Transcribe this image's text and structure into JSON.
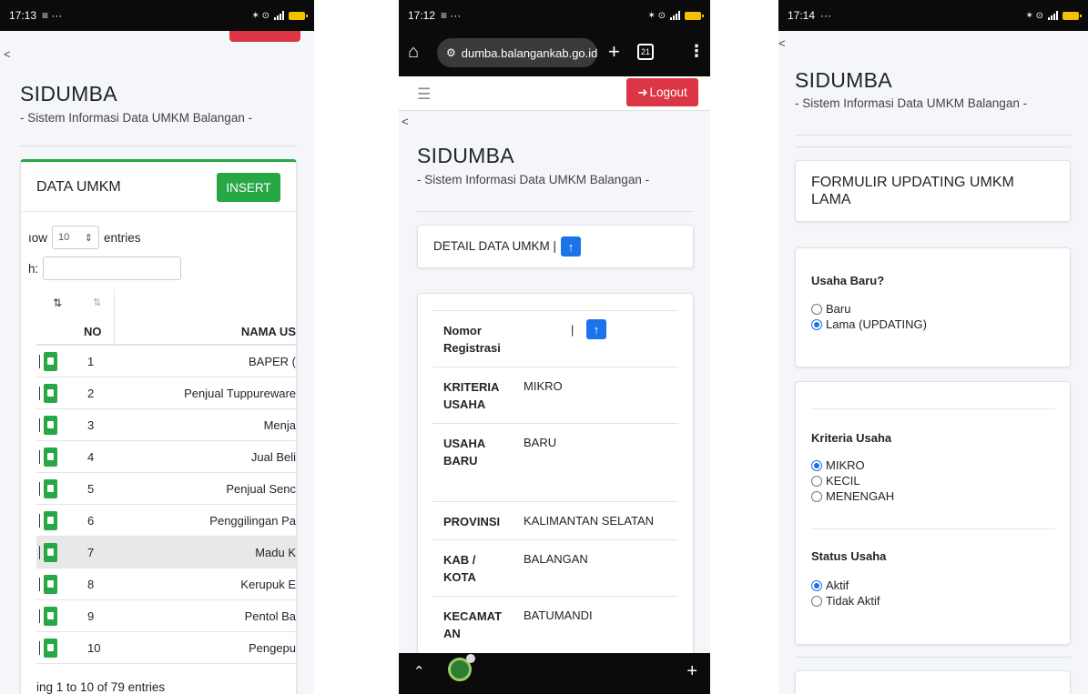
{
  "common": {
    "back": "<",
    "brand": "SIDUMBA",
    "tagline": "- Sistem Informasi Data UMKM Balangan -"
  },
  "phone1": {
    "status": {
      "time": "17:13",
      "icons_left": "≡ ···",
      "net": "✶ ⊙"
    },
    "card_title": "DATA UMKM",
    "insert_label": "INSERT",
    "show_prefix": "ıow",
    "entries_value": "10",
    "show_suffix": "entries",
    "search_label": "h:",
    "sort_icon_1": "⇅",
    "sort_icon_2": "⇅",
    "col_no": "NO",
    "col_nama": "NAMA US",
    "rows": [
      {
        "no": "1",
        "nama": "BAPER ("
      },
      {
        "no": "2",
        "nama": "Penjual Tuppureware"
      },
      {
        "no": "3",
        "nama": "Menja"
      },
      {
        "no": "4",
        "nama": "Jual Beli"
      },
      {
        "no": "5",
        "nama": "Penjual Senc"
      },
      {
        "no": "6",
        "nama": "Penggilingan Pa"
      },
      {
        "no": "7",
        "nama": "Madu K"
      },
      {
        "no": "8",
        "nama": "Kerupuk E"
      },
      {
        "no": "9",
        "nama": "Pentol Ba"
      },
      {
        "no": "10",
        "nama": "Pengepu"
      }
    ],
    "info": "ing 1 to 10 of 79 entries"
  },
  "phone2": {
    "status": {
      "time": "17:12",
      "icons_left": "≡ ···",
      "net": "✶ ⊙"
    },
    "url": "dumba.balangankab.go.id",
    "tab_count": "21",
    "logout_label": "Logout",
    "detail_title": "DETAIL DATA UMKM |",
    "up_glyph": "↑",
    "details": [
      {
        "label": "Nomor Registrasi",
        "value": "|"
      },
      {
        "label": "KRITERIA USAHA",
        "value": "MIKRO"
      },
      {
        "label": "USAHA BARU",
        "value": "BARU"
      },
      {
        "label": "PROVINSI",
        "value": "KALIMANTAN SELATAN"
      },
      {
        "label": "KAB / KOTA",
        "value": "BALANGAN"
      },
      {
        "label": "KECAMAT AN",
        "value": "BATUMANDI"
      }
    ]
  },
  "phone3": {
    "status": {
      "time": "17:14",
      "icons_left": "···",
      "net": "✶ ⊙"
    },
    "form_title": "FORMULIR UPDATING UMKM LAMA",
    "q1": {
      "label": "Usaha Baru?",
      "options": [
        "Baru",
        "Lama (UPDATING)"
      ],
      "selected": 1
    },
    "q2": {
      "label": "Kriteria Usaha",
      "options": [
        "MIKRO",
        "KECIL",
        "MENENGAH"
      ],
      "selected": 0
    },
    "q3": {
      "label": "Status Usaha",
      "options": [
        "Aktif",
        "Tidak Aktif"
      ],
      "selected": 0
    }
  },
  "colors": {
    "green": "#28a745",
    "red": "#dc3545",
    "blue": "#1a73e8"
  }
}
